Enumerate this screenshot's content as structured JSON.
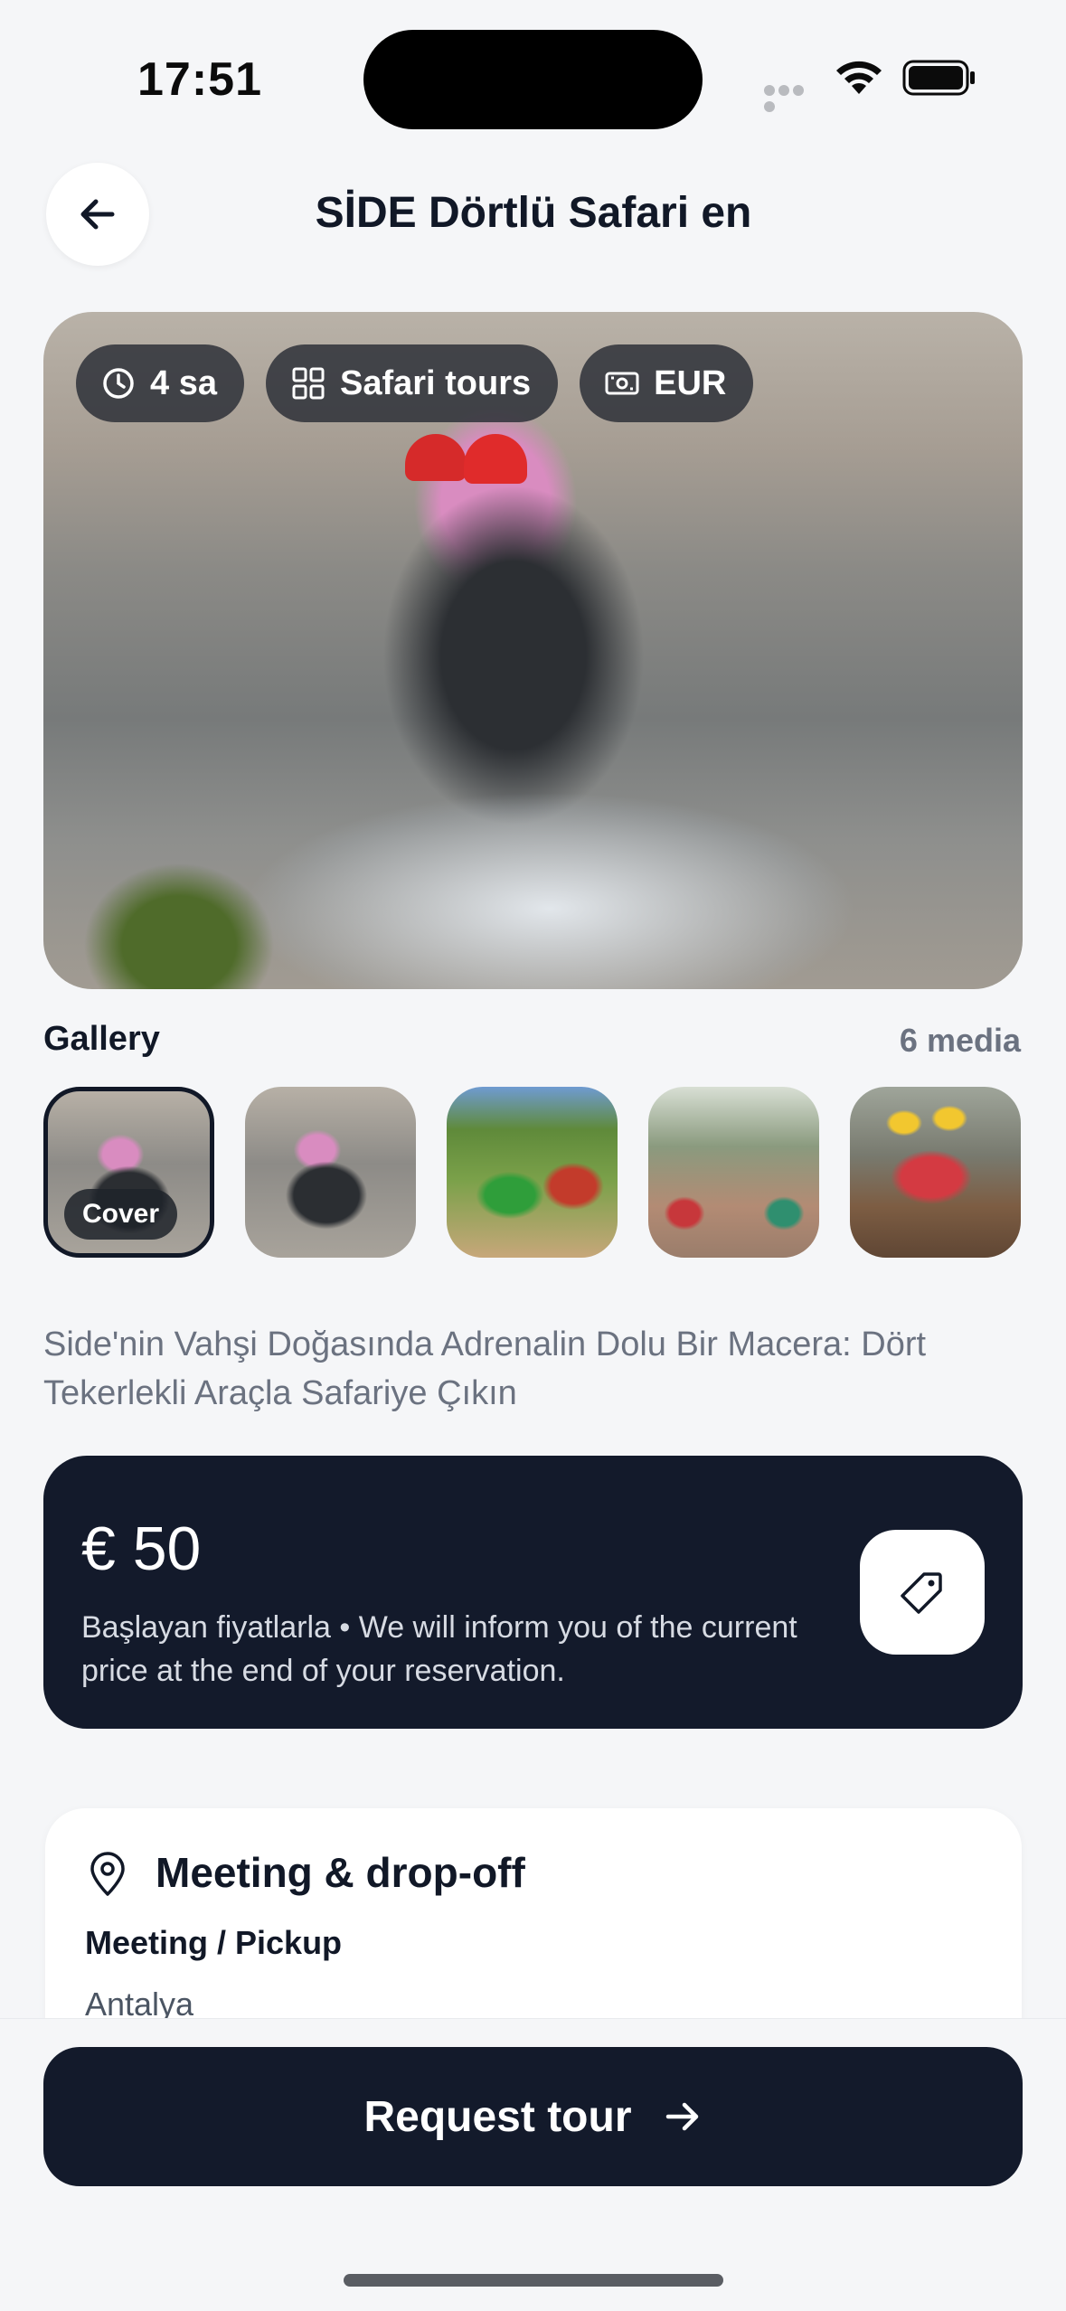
{
  "status_bar": {
    "time": "17:51"
  },
  "header": {
    "title": "SİDE Dörtlü Safari en"
  },
  "hero": {
    "chips": [
      {
        "icon": "clock-icon",
        "label": "4 sa"
      },
      {
        "icon": "grid-icon",
        "label": "Safari tours"
      },
      {
        "icon": "banknote-icon",
        "label": "EUR"
      }
    ]
  },
  "gallery": {
    "title": "Gallery",
    "count": "6 media",
    "cover_label": "Cover",
    "selected_index": 0
  },
  "description": "Side'nin Vahşi Doğasında Adrenalin Dolu Bir Macera: Dört Tekerlekli Araçla Safariye Çıkın",
  "price": {
    "amount": "€ 50",
    "note": "Başlayan fiyatlarla • We will inform you of the current price at the end of your reservation."
  },
  "meeting": {
    "title": "Meeting & drop-off",
    "subtitle": "Meeting / Pickup",
    "location": "Antalya"
  },
  "cta": {
    "label": "Request tour"
  },
  "colors": {
    "dark": "#131a2b",
    "background": "#f5f6f8",
    "muted": "#6b7280"
  }
}
